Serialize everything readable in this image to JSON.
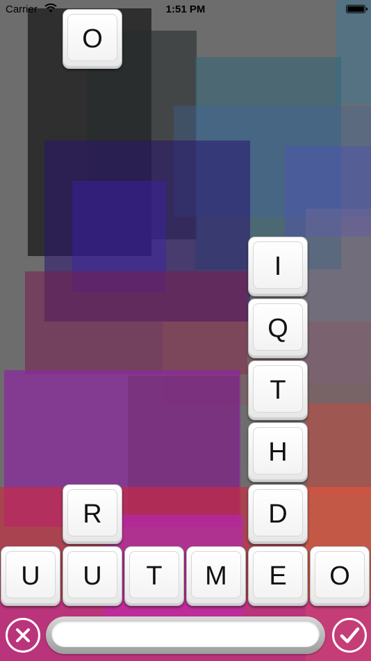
{
  "status_bar": {
    "carrier": "Carrier",
    "time": "1:51 PM",
    "wifi_icon": "wifi-icon",
    "battery_icon": "battery-full-icon"
  },
  "board": {
    "falling_tile": {
      "letter": "O"
    },
    "column_stack": [
      "I",
      "Q",
      "T",
      "H",
      "D"
    ],
    "left_stack": [
      "R"
    ],
    "bottom_row": [
      "U",
      "U",
      "T",
      "M",
      "E",
      "O"
    ]
  },
  "controls": {
    "clear_icon": "close-icon",
    "submit_icon": "checkmark-icon",
    "current_word": ""
  },
  "colors": {
    "background_base": "#7a7a7a",
    "tile_face": "#ffffff",
    "button_stroke": "#ffffff"
  }
}
